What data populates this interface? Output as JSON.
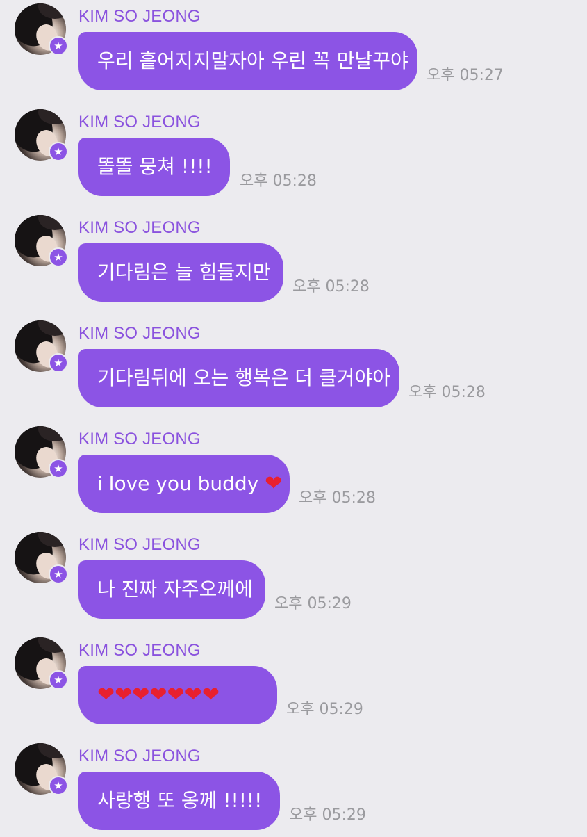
{
  "messages": [
    {
      "sender": "KIM SO JEONG",
      "text": "우리 흩어지지말자아 우린 꼭 만날꾸야",
      "heart": "",
      "time": "오후 05:27"
    },
    {
      "sender": "KIM SO JEONG",
      "text": "똘똘 뭉쳐 !!!!",
      "heart": "",
      "time": "오후 05:28"
    },
    {
      "sender": "KIM SO JEONG",
      "text": "기다림은 늘 힘들지만",
      "heart": "",
      "time": "오후 05:28"
    },
    {
      "sender": "KIM SO JEONG",
      "text": "기다림뒤에 오는 행복은 더 클거야아",
      "heart": "",
      "time": "오후 05:28"
    },
    {
      "sender": "KIM SO JEONG",
      "text": "i love you buddy ",
      "heart": "❤",
      "time": "오후 05:28"
    },
    {
      "sender": "KIM SO JEONG",
      "text": "나 진짜 자주오께에",
      "heart": "",
      "time": "오후 05:29"
    },
    {
      "sender": "KIM SO JEONG",
      "text": "",
      "heart": "❤❤❤❤❤❤❤",
      "time": "오후 05:29"
    },
    {
      "sender": "KIM SO JEONG",
      "text": "사랑행 또 옹께 !!!!!",
      "heart": "",
      "time": "오후 05:29"
    }
  ],
  "icons": {
    "avatar": "profile-photo",
    "badge": "star-icon"
  },
  "colors": {
    "background": "#ECEBEF",
    "bubble": "#8C54E5",
    "name": "#8A52DE",
    "timestamp": "#9A9A9E",
    "heart": "#E8202F"
  }
}
